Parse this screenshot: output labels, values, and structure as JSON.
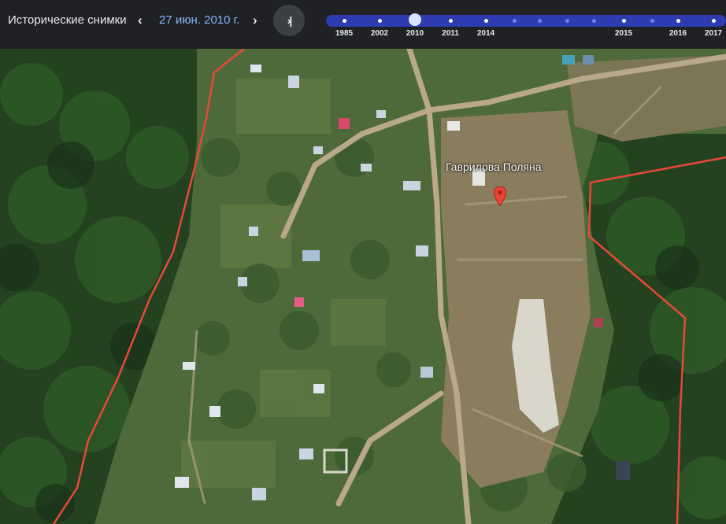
{
  "header": {
    "title": "Исторические снимки",
    "prev_icon": "chevron-left-icon",
    "date": "27 июн. 2010 г.",
    "next_icon": "chevron-right-icon",
    "latest_icon": "skip-to-latest-icon",
    "latest_glyph": "›|"
  },
  "timeline": {
    "selected_year": "2010",
    "labels": [
      "1985",
      "2002",
      "2010",
      "2011",
      "2014",
      "2015",
      "2016",
      "2017"
    ],
    "track_color": "#2f3bb0"
  },
  "map": {
    "place_label": "Гаврилова Поляна",
    "marker_icon": "red-location-pin-icon",
    "boundary_color": "#e8483a"
  }
}
